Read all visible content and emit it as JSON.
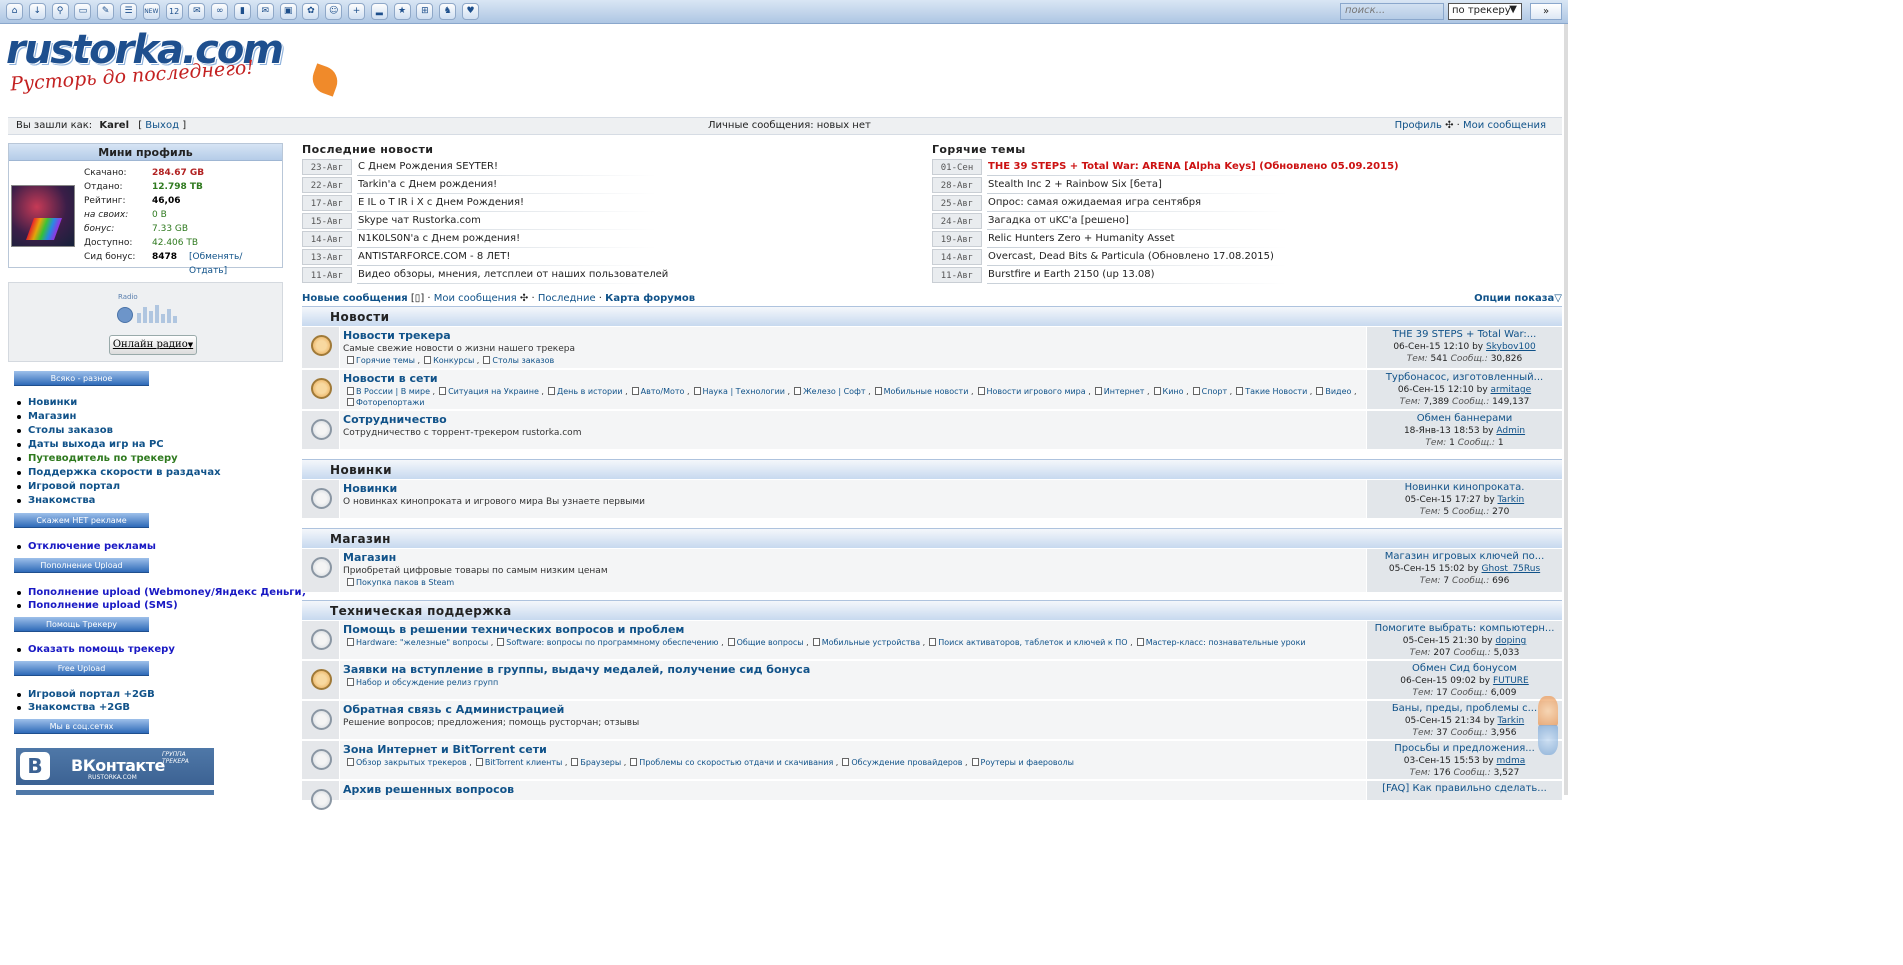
{
  "toolbar": {
    "icons": [
      "home-icon",
      "download-icon",
      "search-icon",
      "book-icon",
      "edit-icon",
      "list-icon",
      "new-icon",
      "calendar-icon",
      "chat-icon",
      "glasses-icon",
      "bookmark-icon",
      "mail-icon",
      "tv-icon",
      "paw-icon",
      "users-icon",
      "add-user-icon",
      "stats-icon",
      "star-icon",
      "cart-icon",
      "gamepad-icon",
      "heart-icon"
    ],
    "new_label": "NEW",
    "calendar_label": "12",
    "search_placeholder": "поиск...",
    "search_scope": "по трекеру",
    "search_go": "»"
  },
  "logo": {
    "title": "rustorka.com",
    "slogan": "Русторь до последнего!"
  },
  "userbar": {
    "logged_as": "Вы зашли как:",
    "username": "Karel",
    "logout": "Выход",
    "pm": "Личные сообщения: новых нет",
    "profile": "Профиль",
    "my_posts": "Мои сообщения"
  },
  "mini_profile": {
    "title": "Мини профиль",
    "stats": [
      {
        "label": "Скачано:",
        "value": "284.67 GB",
        "color": "#b22222"
      },
      {
        "label": "Отдано:",
        "value": "12.798 TB",
        "color": "#2f7a1f"
      },
      {
        "label": "Рейтинг:",
        "value": "46,06",
        "color": "#000000"
      },
      {
        "label": "на своих:",
        "value": "0 B",
        "color": "#2f7a1f"
      },
      {
        "label": "бонус:",
        "value": "7.33 GB",
        "color": "#2f7a1f"
      },
      {
        "label": "Доступно:",
        "value": "42.406 TB",
        "color": "#2f7a1f"
      },
      {
        "label": "Сид бонус:",
        "value": "8478",
        "color": "#000000"
      }
    ],
    "exchange": "[Обменять/Отдать]"
  },
  "radio": {
    "label": "Radio",
    "button": "Онлайн радио"
  },
  "sidebar": {
    "btn_misc": "Всяко - разное",
    "links1": [
      "Новинки",
      "Магазин",
      "Столы заказов",
      "Даты выхода игр на PC",
      "Путеводитель по трекеру",
      "Поддержка скорости в раздачах",
      "Игровой портал",
      "Знакомства"
    ],
    "btn_ads": "Скажем НЕТ рекламе",
    "link_ads": "Отключение рекламы",
    "btn_upload": "Пополнение Upload",
    "links_upload": [
      "Пополнение upload (Webmoney/Яндекс Деньги)",
      "Пополнение upload (SMS)"
    ],
    "btn_help": "Помощь Трекеру",
    "link_help": "Оказать помощь трекеру",
    "btn_free": "Free Upload",
    "links_free": [
      "Игровой портал +2GB",
      "Знакомства +2GB"
    ],
    "btn_social": "Мы в соц.сетях",
    "vk_title": "ВКонтакте",
    "vk_group": "ГРУППА ТРЕКЕРА",
    "vk_site": "RUSTORKA.COM"
  },
  "news": {
    "title": "Последние новости",
    "items": [
      {
        "date": "23-Авг",
        "text": "С Днем Рождения SEYTER!"
      },
      {
        "date": "22-Авг",
        "text": "Tarkin'a с Днем рождения!"
      },
      {
        "date": "17-Авг",
        "text": "E IL o T IR i X с Днем Рождения!"
      },
      {
        "date": "15-Авг",
        "text": "Skype чат Rustorka.com"
      },
      {
        "date": "14-Авг",
        "text": "N1K0LS0N'a с Днем рождения!"
      },
      {
        "date": "13-Авг",
        "text": "ANTISTARFORCE.COM - 8 ЛЕТ!"
      },
      {
        "date": "11-Авг",
        "text": "Видео обзоры, мнения, летсплеи от наших пользователей"
      }
    ]
  },
  "hot": {
    "title": "Горячие темы",
    "items": [
      {
        "date": "01-Сен",
        "text": "THE 39 STEPS + Total War: ARENA [Alpha Keys] (Обновлено 05.09.2015)"
      },
      {
        "date": "28-Авг",
        "text": "Stealth Inc 2 + Rainbow Six [бета]"
      },
      {
        "date": "25-Авг",
        "text": "Опрос: самая ожидаемая игра сентября"
      },
      {
        "date": "24-Авг",
        "text": "Загадка от uKC'a [решено]"
      },
      {
        "date": "19-Авг",
        "text": "Relic Hunters Zero + Humanity Asset"
      },
      {
        "date": "14-Авг",
        "text": "Overcast, Dead Bits & Particula (Обновлено 17.08.2015)"
      },
      {
        "date": "11-Авг",
        "text": "Burstfire и Earth 2150 (up 13.08)"
      }
    ]
  },
  "forum_links": {
    "new_posts": "Новые сообщения",
    "my_posts": "Мои сообщения",
    "last": "Последние",
    "map": "Карта форумов",
    "options": "Опции показа"
  },
  "categories": [
    "Новости",
    "Новинки",
    "Магазин",
    "Техническая поддержка"
  ],
  "forums": [
    {
      "name": "Новости трекера",
      "desc": "Самые свежие новости о жизни нашего трекера",
      "subs": [
        "Горячие темы",
        "Конкурсы",
        "Столы заказов"
      ],
      "lp_title": "THE 39 STEPS + Total War:...",
      "lp_date": "06-Сен-15 12:10",
      "lp_by": "by",
      "lp_user": "Skybov100",
      "topics": "541",
      "posts": "30,826",
      "hot": true
    },
    {
      "name": "Новости в сети",
      "desc": "",
      "subs": [
        "В России | В мире",
        "Ситуация на Украине",
        "День в истории",
        "Авто/Мото",
        "Наука | Технологии",
        "Железо | Софт",
        "Мобильные новости",
        "Новости игрового мира",
        "Интернет",
        "Кино",
        "Спорт",
        "Такие Новости",
        "Видео",
        "Фоторепортажи"
      ],
      "lp_title": "Турбонасос, изготовленный...",
      "lp_date": "06-Сен-15 12:10",
      "lp_by": "by",
      "lp_user": "armitage",
      "topics": "7,389",
      "posts": "149,137",
      "hot": true
    },
    {
      "name": "Сотрудничество",
      "desc": "Сотрудничество с торрент-трекером rustorka.com",
      "subs": [],
      "lp_title": "Обмен баннерами",
      "lp_date": "18-Янв-13 18:53",
      "lp_by": "by",
      "lp_user": "Admin",
      "topics": "1",
      "posts": "1",
      "hot": false
    },
    {
      "name": "Новинки",
      "desc": "О новинках кинопроката и игрового мира Вы узнаете первыми",
      "subs": [],
      "lp_title": "Новинки кинопроката.",
      "lp_date": "05-Сен-15 17:27",
      "lp_by": "by",
      "lp_user": "Tarkin",
      "topics": "5",
      "posts": "270",
      "hot": false
    },
    {
      "name": "Магазин",
      "desc": "Приобретай цифровые товары по самым низким ценам",
      "subs": [
        "Покупка паков в Steam"
      ],
      "lp_title": "Магазин игровых ключей по...",
      "lp_date": "05-Сен-15 15:02",
      "lp_by": "by",
      "lp_user": "Ghost_75Rus",
      "topics": "7",
      "posts": "696",
      "hot": false
    },
    {
      "name": "Помощь в решении технических вопросов и проблем",
      "desc": "",
      "subs": [
        "Hardware: \"железные\" вопросы",
        "Software: вопросы по программному обеспечению",
        "Общие вопросы",
        "Мобильные устройства",
        "Поиск активаторов, таблеток и ключей к ПО",
        "Мастер-класс: познавательные уроки"
      ],
      "lp_title": "Помогите выбрать: компьютерн...",
      "lp_date": "05-Сен-15 21:30",
      "lp_by": "by",
      "lp_user": "doping",
      "topics": "207",
      "posts": "5,033",
      "hot": false
    },
    {
      "name": "Заявки на вступление в группы, выдачу медалей, получение сид бонуса",
      "desc": "",
      "subs": [
        "Набор и обсуждение релиз групп"
      ],
      "lp_title": "Обмен Сид бонусом",
      "lp_date": "06-Сен-15 09:02",
      "lp_by": "by",
      "lp_user": "FUTURE",
      "topics": "17",
      "posts": "6,009",
      "hot": true
    },
    {
      "name": "Обратная связь с Администрацией",
      "desc": "Решение вопросов; предложения; помощь русторчан; отзывы",
      "subs": [],
      "lp_title": "Баны, преды, проблемы с...",
      "lp_date": "05-Сен-15 21:34",
      "lp_by": "by",
      "lp_user": "Tarkin",
      "topics": "37",
      "posts": "3,956",
      "hot": false
    },
    {
      "name": "Зона Интернет и BitTorrent сети",
      "desc": "",
      "subs": [
        "Обзор закрытых трекеров",
        "BitTorrent клиенты",
        "Браузеры",
        "Проблемы со скоростью отдачи и скачивания",
        "Обсуждение провайдеров",
        "Роутеры и фаероволы"
      ],
      "lp_title": "Просьбы и предложения...",
      "lp_date": "03-Сен-15 15:53",
      "lp_by": "by",
      "lp_user": "mdma",
      "topics": "176",
      "posts": "3,527",
      "hot": false
    },
    {
      "name": "Архив решенных вопросов",
      "desc": "",
      "subs": [],
      "lp_title": "[FAQ] Как правильно сделать...",
      "lp_date": "",
      "lp_by": "",
      "lp_user": "",
      "topics": "",
      "posts": "",
      "hot": false
    }
  ],
  "labels": {
    "topics": "Тем:",
    "posts": "Сообщ.:"
  }
}
